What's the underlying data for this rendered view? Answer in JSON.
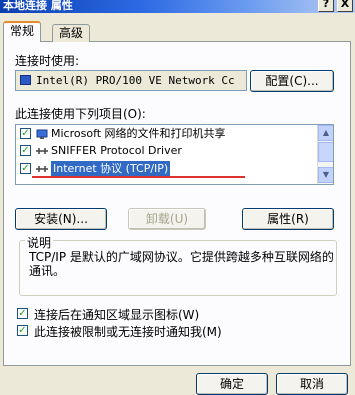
{
  "window": {
    "title": "本地连接 属性",
    "help_button": "?",
    "close_button": "X"
  },
  "tabs": [
    {
      "label": "常规"
    },
    {
      "label": "高级"
    }
  ],
  "connect_using": {
    "label": "连接时使用:",
    "adapter": "Intel(R) PRO/100 VE Network Cc",
    "configure_button": "配置(C)..."
  },
  "components": {
    "label": "此连接使用下列项目(O):",
    "items": [
      {
        "label": "Microsoft 网络的文件和打印机共享",
        "checked": true,
        "selected": false,
        "icon": "service-icon"
      },
      {
        "label": "SNIFFER Protocol Driver",
        "checked": true,
        "selected": false,
        "icon": "protocol-icon"
      },
      {
        "label": "Internet 协议 (TCP/IP)",
        "checked": true,
        "selected": true,
        "icon": "protocol-icon"
      }
    ]
  },
  "actions": {
    "install": "安装(N)...",
    "uninstall": "卸载(U)",
    "properties": "属性(R)"
  },
  "description": {
    "title": "说明",
    "text": "TCP/IP 是默认的广域网协议。它提供跨越多种互联网络的通讯。"
  },
  "options": [
    {
      "label": "连接后在通知区域显示图标(W)",
      "checked": true
    },
    {
      "label": "此连接被限制或无连接时通知我(M)",
      "checked": true
    }
  ],
  "footer": {
    "ok": "确定",
    "cancel": "取消"
  },
  "colors": {
    "selection": "#316ac5",
    "annotation_underline": "#e03030",
    "titlebar": "#0a3fb2"
  }
}
